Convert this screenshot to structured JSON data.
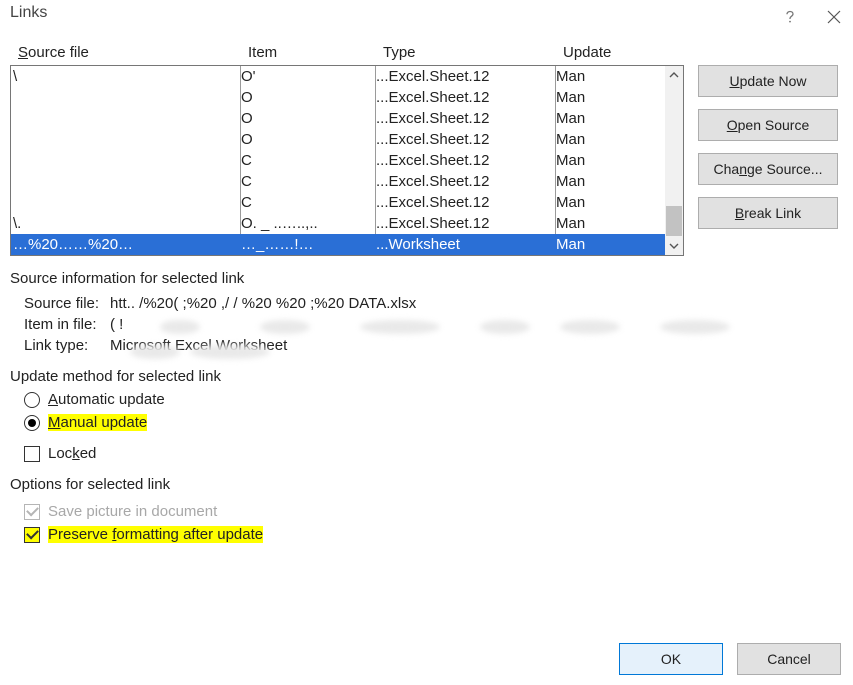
{
  "title": "Links",
  "columns": {
    "source": "Source file",
    "item": "Item",
    "type": "Type",
    "update": "Update"
  },
  "rows": [
    {
      "src": "\\",
      "item": "O'",
      "type": "Excel.Sheet.12",
      "upd": "Man",
      "sel": false
    },
    {
      "src": "",
      "item": "O",
      "type": "Excel.Sheet.12",
      "upd": "Man",
      "sel": false
    },
    {
      "src": "",
      "item": "O",
      "type": "Excel.Sheet.12",
      "upd": "Man",
      "sel": false
    },
    {
      "src": "",
      "item": "O",
      "type": "Excel.Sheet.12",
      "upd": "Man",
      "sel": false
    },
    {
      "src": "",
      "item": "C",
      "type": "Excel.Sheet.12",
      "upd": "Man",
      "sel": false
    },
    {
      "src": "",
      "item": "C",
      "type": "Excel.Sheet.12",
      "upd": "Man",
      "sel": false
    },
    {
      "src": "",
      "item": "C",
      "type": "Excel.Sheet.12",
      "upd": "Man",
      "sel": false
    },
    {
      "src": "\\.",
      "item": "O.  _  ..…..,..",
      "type": "Excel.Sheet.12",
      "upd": "Man",
      "sel": false
    },
    {
      "src": "…%20……%20…",
      "item": "…_……!…",
      "type": "Worksheet",
      "upd": "Man",
      "sel": true
    }
  ],
  "buttons": {
    "update_now": "Update Now",
    "open_source": "Open Source",
    "change_source": "Change Source...",
    "break_link": "Break Link",
    "ok": "OK",
    "cancel": "Cancel"
  },
  "sections": {
    "info": "Source information for selected link",
    "method": "Update method for selected link",
    "options": "Options for selected link"
  },
  "info": {
    "source_key": "Source file:",
    "source_val": "htt..      /%20(        ;%20     ,/                  /       %20        %20           ;%20         DATA.xlsx",
    "item_key": "Item in file:",
    "item_val": "(        !",
    "linktype_key": "Link type:",
    "linktype_val": "Microsoft Excel Worksheet"
  },
  "radios": {
    "auto": "Automatic update",
    "manual": "Manual update"
  },
  "checks": {
    "locked": "Locked",
    "save_pic": "Save picture in document",
    "preserve": "Preserve formatting after update"
  },
  "mnemonic": {
    "source_col": "S",
    "update_now": "U",
    "open_source": "O",
    "change_source_trail": "",
    "break_link": "B",
    "auto": "A",
    "manual": "M",
    "preserve": "f"
  }
}
